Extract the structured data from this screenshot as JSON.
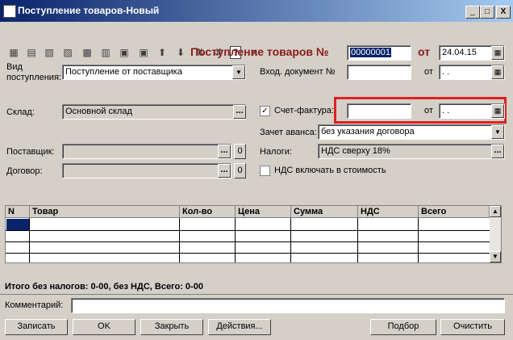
{
  "window": {
    "title": "Поступление товаров-Новый",
    "minimize_glyph": "_",
    "maximize_glyph": "□",
    "close_glyph": "X"
  },
  "toolbar": {
    "icons": [
      "new-icon",
      "copy-icon",
      "edit-icon",
      "delete-icon",
      "mark-icon",
      "tree-icon",
      "hierarchy-icon",
      "move-up-icon",
      "move-down-icon",
      "sort-asc-icon",
      "sort-desc-icon",
      "help-icon",
      "whats-this-icon"
    ],
    "glyphs": [
      "▦",
      "▤",
      "▧",
      "▨",
      "▩",
      "▥",
      "▣",
      "⬆",
      "⬇",
      "⇅",
      "⇵",
      "?",
      "↖"
    ]
  },
  "header": {
    "doc_title": "Поступление товаров №",
    "doc_number": "00000001",
    "date_label": "от",
    "doc_date": "24.04.15"
  },
  "form": {
    "vid_label": "Вид поступления:",
    "vid_value": "Поступление от поставщика",
    "incoming_doc_label": "Вход. документ №",
    "incoming_doc_value": "",
    "incoming_date_label": "от",
    "incoming_date_value": ". .",
    "sklad_label": "Склад:",
    "sklad_value": "Основной склад",
    "invoice_checkbox": "✓",
    "invoice_label": "Счет-фактура:",
    "invoice_value": "",
    "invoice_date_label": "от",
    "invoice_date_value": ". .",
    "advance_label": "Зачет аванса:",
    "advance_value": "без указания договора",
    "supplier_label": "Поставщик:",
    "supplier_value": "",
    "taxes_label": "Налоги:",
    "taxes_value": "НДС сверху 18%",
    "contract_label": "Договор:",
    "contract_value": "",
    "vat_include_label": "НДС включать в стоимость",
    "vat_include_checked": false,
    "o_button": "0",
    "dots_button": "..."
  },
  "table": {
    "columns": [
      "N",
      "Товар",
      "Кол-во",
      "Цена",
      "Сумма",
      "НДС",
      "Всего"
    ]
  },
  "totals": {
    "text": "Итого без налогов: 0-00, без НДС, Всего: 0-00"
  },
  "comment": {
    "label": "Комментарий:",
    "value": ""
  },
  "buttons": {
    "save": "Записать",
    "ok": "OK",
    "close": "Закрыть",
    "actions": "Действия...",
    "pick": "Подбор",
    "clear": "Очистить"
  }
}
